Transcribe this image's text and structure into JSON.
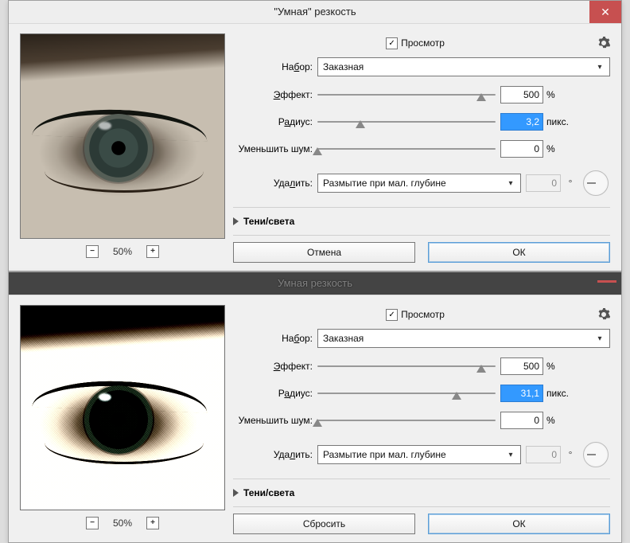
{
  "windows": [
    {
      "title": "\"Умная\" резкость",
      "close_visible": true,
      "shadowed": false,
      "preview": {
        "zoom": "50%",
        "oversharp": false
      },
      "controls": {
        "preview_checkbox": {
          "label": "Просмотр",
          "checked": true
        },
        "preset": {
          "label_pre": "На",
          "label_ul": "б",
          "label_post": "ор:",
          "value": "Заказная"
        },
        "amount": {
          "label_ul": "Э",
          "label_post": "ффект:",
          "value": "500",
          "unit": "%",
          "thumb_pct": 92
        },
        "radius": {
          "label_pre": "Р",
          "label_ul": "а",
          "label_post": "диус:",
          "value": "3,2",
          "unit": "пикс.",
          "highlighted": true,
          "thumb_pct": 24
        },
        "noise": {
          "label": "Уменьшить шум:",
          "value": "0",
          "unit": "%",
          "thumb_pct": 0
        },
        "remove": {
          "label_pre": "Уда",
          "label_ul": "л",
          "label_post": "ить:",
          "select": "Размытие при мал. глубине",
          "angle": "0",
          "deg": "°"
        },
        "section": "Тени/света",
        "btn_left": "Отмена",
        "btn_right": "ОК"
      }
    },
    {
      "title": "Умная  резкость",
      "close_visible": true,
      "shadowed": true,
      "preview": {
        "zoom": "50%",
        "oversharp": true
      },
      "controls": {
        "preview_checkbox": {
          "label": "Просмотр",
          "checked": true
        },
        "preset": {
          "label_pre": "На",
          "label_ul": "б",
          "label_post": "ор:",
          "value": "Заказная"
        },
        "amount": {
          "label_ul": "Э",
          "label_post": "ффект:",
          "value": "500",
          "unit": "%",
          "thumb_pct": 92
        },
        "radius": {
          "label_pre": "Р",
          "label_ul": "а",
          "label_post": "диус:",
          "value": "31,1",
          "unit": "пикс.",
          "highlighted": true,
          "thumb_pct": 78
        },
        "noise": {
          "label": "Уменьшить шум:",
          "value": "0",
          "unit": "%",
          "thumb_pct": 0
        },
        "remove": {
          "label_pre": "Уда",
          "label_ul": "л",
          "label_post": "ить:",
          "select": "Размытие при мал. глубине",
          "angle": "0",
          "deg": "°"
        },
        "section": "Тени/света",
        "btn_left": "Сбросить",
        "btn_right": "ОК"
      }
    }
  ]
}
